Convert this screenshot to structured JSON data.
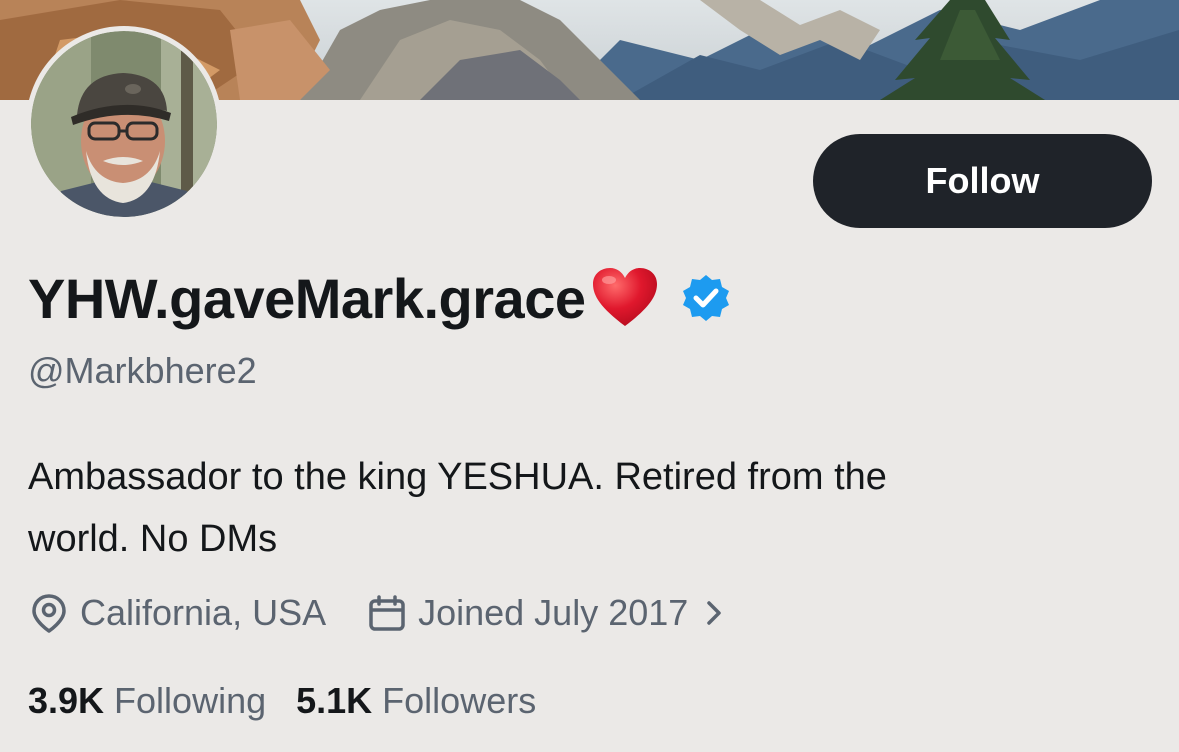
{
  "profile": {
    "display_name": "YHW.gaveMark.grace",
    "handle": "@Markbhere2",
    "bio_lines": [
      "Ambassador to the king YESHUA. Retired from the",
      "world. No DMs"
    ],
    "location": "California, USA",
    "joined": "Joined July 2017"
  },
  "stats": {
    "following_count": "3.9K",
    "following_label": "Following",
    "followers_count": "5.1K",
    "followers_label": "Followers"
  },
  "actions": {
    "follow_label": "Follow"
  },
  "icons": {
    "heart": "red-heart-emoji",
    "verified": "verified-badge-icon",
    "location": "location-pin-icon",
    "calendar": "calendar-icon",
    "chevron": "chevron-right-icon"
  },
  "colors": {
    "background": "#ebe9e7",
    "button_bg": "#1f2329",
    "button_text": "#ffffff",
    "primary_text": "#14171a",
    "secondary_text": "#5b6470",
    "verified_blue": "#1d9bf0",
    "heart_red": "#e0182d"
  }
}
